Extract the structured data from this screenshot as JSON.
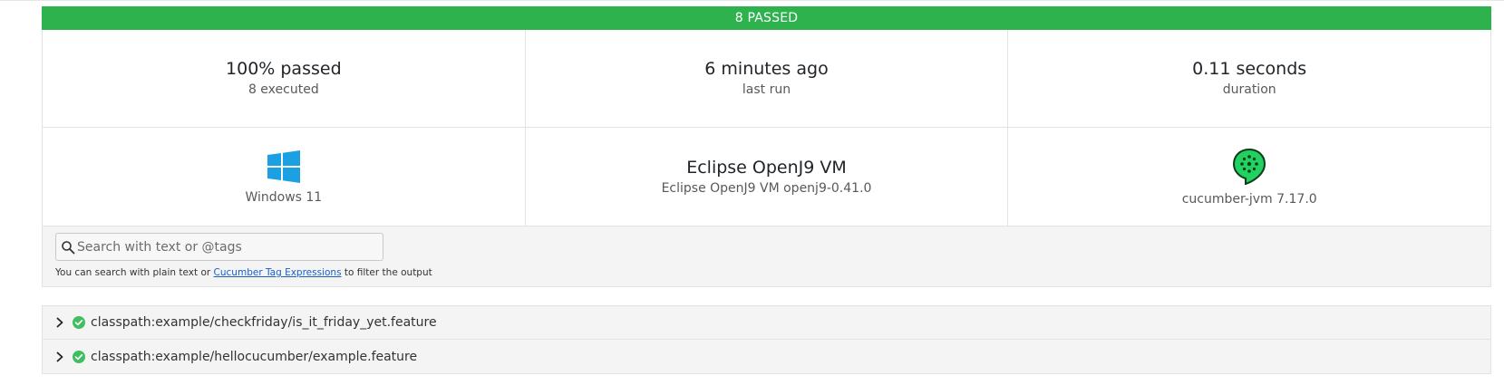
{
  "banner": {
    "text": "8 PASSED",
    "color": "#2db24d"
  },
  "stats": {
    "passed": {
      "value": "100% passed",
      "caption": "8 executed"
    },
    "last_run": {
      "value": "6 minutes ago",
      "caption": "last run"
    },
    "duration": {
      "value": "0.11 seconds",
      "caption": "duration"
    }
  },
  "environment": {
    "os": {
      "icon": "windows-logo-icon",
      "label": "Windows 11"
    },
    "runtime": {
      "value": "Eclipse OpenJ9 VM",
      "caption": "Eclipse OpenJ9 VM openj9-0.41.0"
    },
    "implementation": {
      "icon": "cucumber-logo-icon",
      "label": "cucumber-jvm 7.17.0"
    }
  },
  "search": {
    "placeholder": "Search with text or @tags",
    "help_prefix": "You can search with plain text or ",
    "help_link": "Cucumber Tag Expressions",
    "help_suffix": " to filter the output"
  },
  "features": [
    {
      "label": "classpath:example/checkfriday/is_it_friday_yet.feature",
      "status": "passed"
    },
    {
      "label": "classpath:example/hellocucumber/example.feature",
      "status": "passed"
    }
  ],
  "colors": {
    "passed": "#2db24d",
    "windows_blue": "#0ea5e9",
    "cucumber_green": "#23d160"
  }
}
